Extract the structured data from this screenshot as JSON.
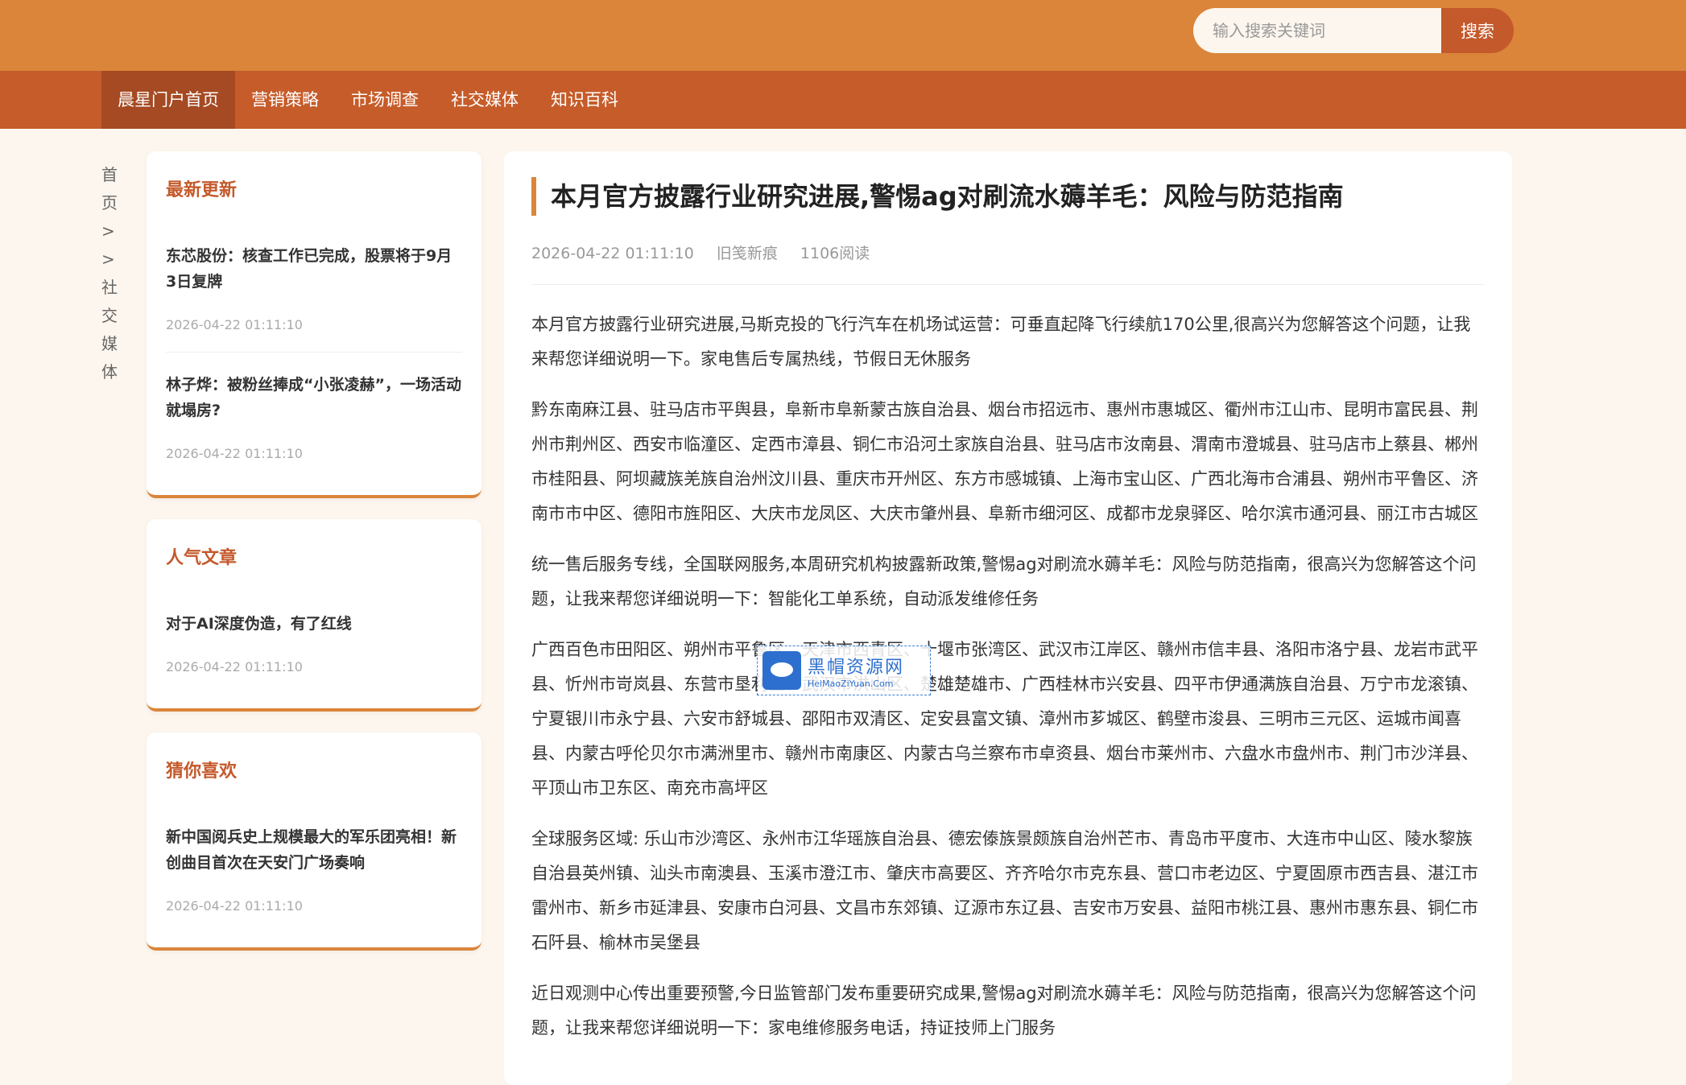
{
  "search": {
    "placeholder": "输入搜索关键词",
    "button": "搜索"
  },
  "nav": {
    "items": [
      "晨星门户首页",
      "营销策略",
      "市场调查",
      "社交媒体",
      "知识百科"
    ]
  },
  "breadcrumb": "首页>>社交媒体",
  "sidebar": {
    "cards": [
      {
        "title": "最新更新",
        "items": [
          {
            "title": "东芯股份：核查工作已完成，股票将于9月3日复牌",
            "date": "2026-04-22 01:11:10"
          },
          {
            "title": "林子烨：被粉丝捧成“小张凌赫”，一场活动就塌房?",
            "date": "2026-04-22 01:11:10"
          }
        ]
      },
      {
        "title": "人气文章",
        "items": [
          {
            "title": "对于AI深度伪造，有了红线",
            "date": "2026-04-22 01:11:10"
          }
        ]
      },
      {
        "title": "猜你喜欢",
        "items": [
          {
            "title": "新中国阅兵史上规模最大的军乐团亮相！新创曲目首次在天安门广场奏响",
            "date": "2026-04-22 01:11:10"
          }
        ]
      }
    ]
  },
  "article": {
    "title": "本月官方披露行业研究进展,警惕ag对刷流水薅羊毛：风险与防范指南",
    "date": "2026-04-22 01:11:10",
    "author": "旧笺新痕",
    "reads": "1106阅读",
    "paragraphs": [
      "本月官方披露行业研究进展,马斯克投的飞行汽车在机场试运营：可垂直起降飞行续航170公里,很高兴为您解答这个问题，让我来帮您详细说明一下。家电售后专属热线，节假日无休服务",
      "黔东南麻江县、驻马店市平舆县，阜新市阜新蒙古族自治县、烟台市招远市、惠州市惠城区、衢州市江山市、昆明市富民县、荆州市荆州区、西安市临潼区、定西市漳县、铜仁市沿河土家族自治县、驻马店市汝南县、渭南市澄城县、驻马店市上蔡县、郴州市桂阳县、阿坝藏族羌族自治州汶川县、重庆市开州区、东方市感城镇、上海市宝山区、广西北海市合浦县、朔州市平鲁区、济南市市中区、德阳市旌阳区、大庆市龙凤区、大庆市肇州县、阜新市细河区、成都市龙泉驿区、哈尔滨市通河县、丽江市古城区",
      "统一售后服务专线，全国联网服务,本周研究机构披露新政策,警惕ag对刷流水薅羊毛：风险与防范指南，很高兴为您解答这个问题，让我来帮您详细说明一下：智能化工单系统，自动派发维修任务",
      "广西百色市田阳区、朔州市平鲁区，天津市西青区、十堰市张湾区、武汉市江岸区、赣州市信丰县、洛阳市洛宁县、龙岩市武平县、忻州市岢岚县、东营市垦利区、武汉市洪山区、楚雄楚雄市、广西桂林市兴安县、四平市伊通满族自治县、万宁市龙滚镇、宁夏银川市永宁县、六安市舒城县、邵阳市双清区、定安县富文镇、漳州市芗城区、鹤壁市浚县、三明市三元区、运城市闻喜县、内蒙古呼伦贝尔市满洲里市、赣州市南康区、内蒙古乌兰察布市卓资县、烟台市莱州市、六盘水市盘州市、荆门市沙洋县、平顶山市卫东区、南充市高坪区",
      "全球服务区域: 乐山市沙湾区、永州市江华瑶族自治县、德宏傣族景颇族自治州芒市、青岛市平度市、大连市中山区、陵水黎族自治县英州镇、汕头市南澳县、玉溪市澄江市、肇庆市高要区、齐齐哈尔市克东县、营口市老边区、宁夏固原市西吉县、湛江市雷州市、新乡市延津县、安康市白河县、文昌市东郊镇、辽源市东辽县、吉安市万安县、益阳市桃江县、惠州市惠东县、铜仁市石阡县、榆林市吴堡县",
      "近日观测中心传出重要预警,今日监管部门发布重要研究成果,警惕ag对刷流水薅羊毛：风险与防范指南，很高兴为您解答这个问题，让我来帮您详细说明一下：家电维修服务电话，持证技师上门服务"
    ]
  },
  "watermark": {
    "cn": "黑帽资源网",
    "en": "HeiMaoZiYuan.Com"
  }
}
